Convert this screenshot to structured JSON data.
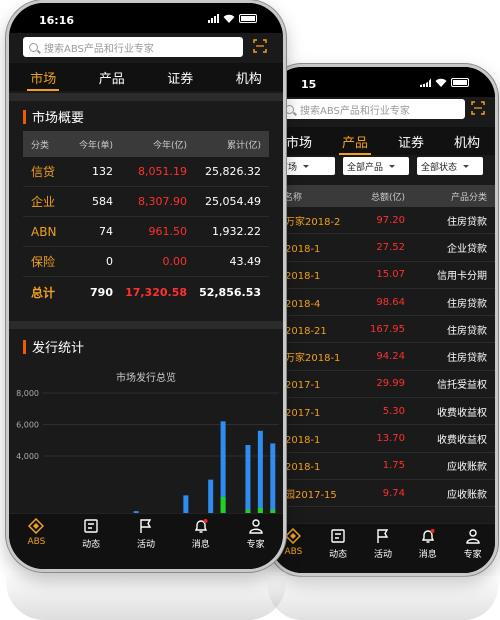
{
  "front": {
    "status": {
      "time": "16:16"
    },
    "search": {
      "placeholder": "搜索ABS产品和行业专家"
    },
    "tabs": [
      "市场",
      "产品",
      "证券",
      "机构"
    ],
    "overview": {
      "title": "市场概要",
      "headers": [
        "分类",
        "今年(单)",
        "今年(亿)",
        "累计(亿)"
      ],
      "rows": [
        {
          "cat": "信贷",
          "count": "132",
          "amount": "8,051.19",
          "cumulative": "25,826.32"
        },
        {
          "cat": "企业",
          "count": "584",
          "amount": "8,307.90",
          "cumulative": "25,054.49"
        },
        {
          "cat": "ABN",
          "count": "74",
          "amount": "961.50",
          "cumulative": "1,932.22"
        },
        {
          "cat": "保险",
          "count": "0",
          "amount": "0.00",
          "cumulative": "43.49"
        }
      ],
      "total": {
        "cat": "总计",
        "count": "790",
        "amount": "17,320.58",
        "cumulative": "52,856.53"
      }
    },
    "issuance": {
      "title": "发行统计",
      "chart_title": "市场发行总览"
    },
    "nav": [
      "ABS",
      "动态",
      "活动",
      "消息",
      "专家"
    ]
  },
  "chart_data": {
    "type": "bar",
    "title": "市场发行总览",
    "ylim": [
      0,
      8000
    ],
    "yticks": [
      "8,000",
      "6,000",
      "4,000"
    ],
    "series": [
      {
        "color": "#2f8cf0",
        "values": [
          0,
          0,
          0,
          0,
          0,
          0,
          0,
          500,
          0,
          50,
          150,
          1500,
          200,
          2500,
          6200,
          0,
          4700,
          5600,
          4800
        ]
      },
      {
        "color": "#22d022",
        "values": [
          0,
          0,
          0,
          0,
          0,
          0,
          0,
          0,
          0,
          0,
          0,
          0,
          0,
          300,
          1400,
          0,
          600,
          700,
          600
        ]
      }
    ],
    "grid": true
  },
  "back": {
    "status": {
      "time": "15"
    },
    "search": {
      "placeholder": "搜索ABS产品和行业专家"
    },
    "tabs": [
      "市场",
      "产品",
      "证券",
      "机构"
    ],
    "filters": [
      "市场",
      "全部产品",
      "全部状态"
    ],
    "headers": [
      "品名称",
      "总额(亿)",
      "产品分类"
    ],
    "rows": [
      {
        "name": "盈万家2018-2",
        "amount": "97.20",
        "category": "住房贷款"
      },
      {
        "name": "江2018-1",
        "amount": "27.52",
        "category": "企业贷款"
      },
      {
        "name": "信2018-1",
        "amount": "15.07",
        "category": "信用卡分期"
      },
      {
        "name": "元2018-4",
        "amount": "98.64",
        "category": "住房贷款"
      },
      {
        "name": "元2018-21",
        "amount": "167.95",
        "category": "住房贷款"
      },
      {
        "name": "盈万家2018-1",
        "amount": "94.24",
        "category": "住房贷款"
      },
      {
        "name": "聚2017-1",
        "amount": "29.99",
        "category": "信托受益权"
      },
      {
        "name": "桥2017-1",
        "amount": "5.30",
        "category": "收费收益权"
      },
      {
        "name": "供2018-1",
        "amount": "13.70",
        "category": "收费收益权"
      },
      {
        "name": "铁2018-1",
        "amount": "1.75",
        "category": "应收账款"
      },
      {
        "name": "桂园2017-15",
        "amount": "9.74",
        "category": "应收账款"
      }
    ],
    "nav": [
      "ABS",
      "动态",
      "活动",
      "消息",
      "专家"
    ]
  }
}
